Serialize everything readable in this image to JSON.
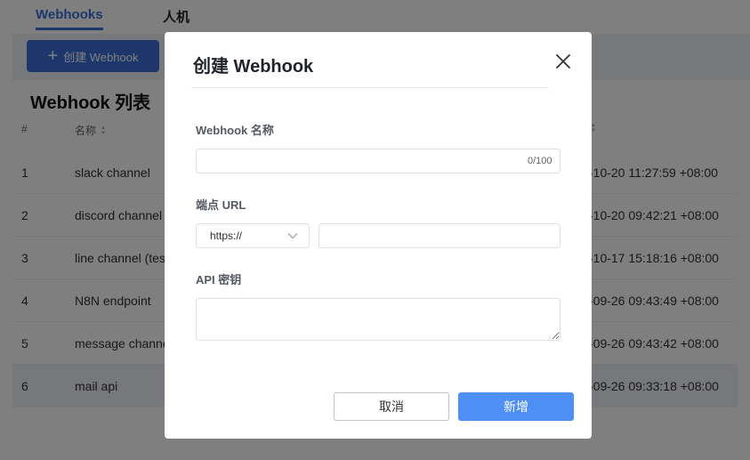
{
  "tabs": {
    "webhooks": "Webhooks",
    "human": "人机"
  },
  "toolbar": {
    "create_label": "创建 Webhook"
  },
  "list": {
    "title": "Webhook 列表",
    "headers": {
      "index": "#",
      "name": "名称"
    },
    "rows": [
      {
        "index": "1",
        "name": "slack channel",
        "time": "-10-20 11:27:59 +08:00"
      },
      {
        "index": "2",
        "name": "discord channel",
        "time": "-10-20 09:42:21 +08:00"
      },
      {
        "index": "3",
        "name": "line channel (tes",
        "time": "-10-17 15:18:16 +08:00"
      },
      {
        "index": "4",
        "name": "N8N endpoint",
        "time": "-09-26 09:43:49 +08:00"
      },
      {
        "index": "5",
        "name": "message channe",
        "time": "-09-26 09:43:42 +08:00"
      },
      {
        "index": "6",
        "name": "mail api",
        "time": "-09-26 09:33:18 +08:00"
      }
    ]
  },
  "dialog": {
    "title": "创建 Webhook",
    "name_label": "Webhook 名称",
    "name_value": "",
    "name_counter": "0/100",
    "url_label": "端点 URL",
    "protocol": "https://",
    "url_value": "",
    "api_key_label": "API 密钥",
    "api_key_value": "",
    "cancel_label": "取消",
    "submit_label": "新增"
  },
  "colors": {
    "primary": "#4d8ff5",
    "tab_active": "#3a6fd8",
    "overlay": "rgba(0,0,0,0.5)"
  }
}
